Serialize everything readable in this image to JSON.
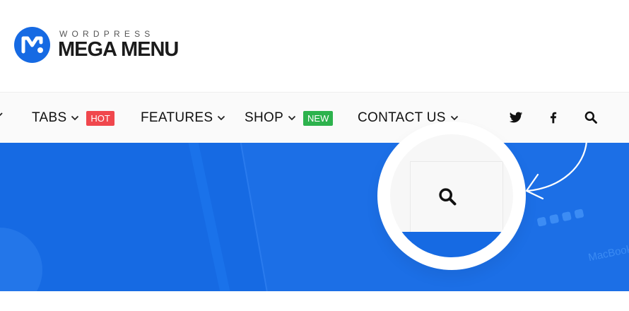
{
  "logo": {
    "top_text": "WORDPRESS",
    "main_text": "MEGA MENU",
    "brand_color": "#166ae3"
  },
  "nav": {
    "items": [
      {
        "label": "TABS",
        "badge": "HOT",
        "badge_color": "#f0474d"
      },
      {
        "label": "FEATURES"
      },
      {
        "label": "SHOP",
        "badge": "NEW",
        "badge_color": "#2db24d"
      },
      {
        "label": "CONTACT US"
      }
    ],
    "icons": [
      "twitter-icon",
      "facebook-icon",
      "search-icon"
    ]
  },
  "hero": {
    "background_color": "#166ae3"
  },
  "callout": {
    "icon": "search-icon"
  }
}
